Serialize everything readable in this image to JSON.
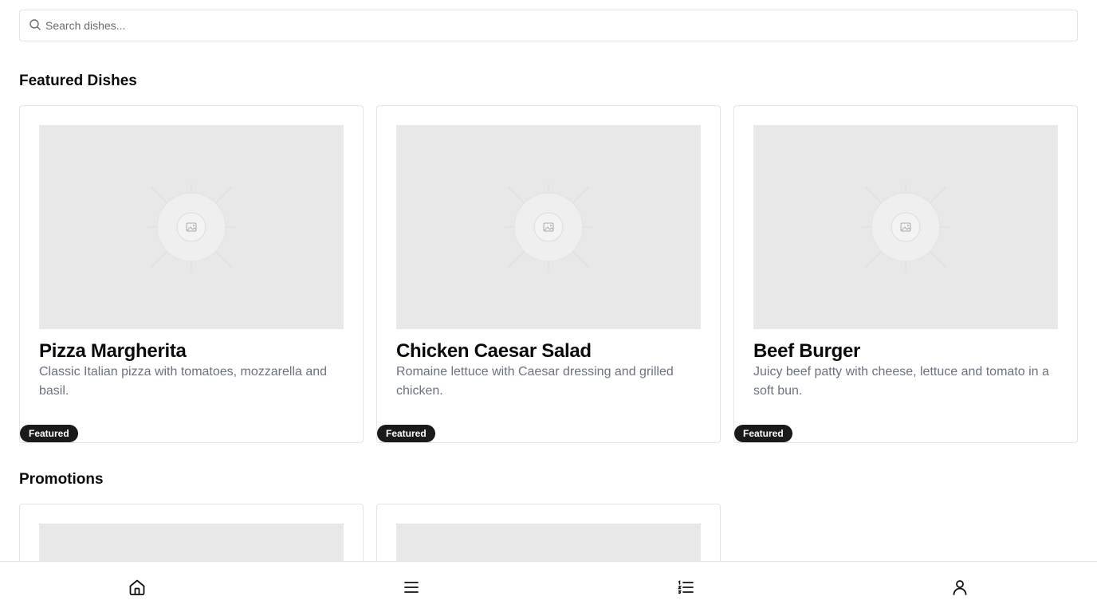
{
  "search": {
    "placeholder": "Search dishes..."
  },
  "sections": {
    "featured_title": "Featured Dishes",
    "promotions_title": "Promotions"
  },
  "featured_dishes": [
    {
      "name": "Pizza Margherita",
      "description": "Classic Italian pizza with tomatoes, mozzarella and basil.",
      "badge": "Featured"
    },
    {
      "name": "Chicken Caesar Salad",
      "description": "Romaine lettuce with Caesar dressing and grilled chicken.",
      "badge": "Featured"
    },
    {
      "name": "Beef Burger",
      "description": "Juicy beef patty with cheese, lettuce and tomato in a soft bun.",
      "badge": "Featured"
    }
  ],
  "bottom_nav": [
    {
      "icon": "home-icon"
    },
    {
      "icon": "menu-icon"
    },
    {
      "icon": "list-icon"
    },
    {
      "icon": "user-icon"
    }
  ],
  "colors": {
    "badge_bg": "#1a1a1a",
    "description_text": "#6b7280",
    "placeholder_bg": "#e8e8e8",
    "border": "#e4e4e7"
  }
}
